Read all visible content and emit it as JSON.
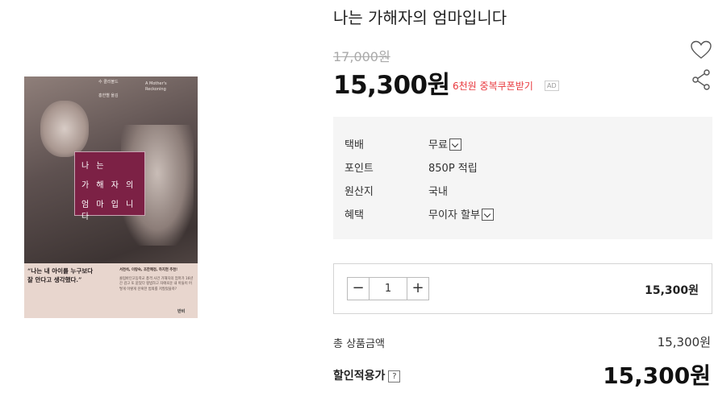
{
  "product": {
    "title": "나는 가해자의 엄마입니다",
    "original_price": "17,000원",
    "sale_price": "15,300원",
    "coupon_text": "6천원 중복쿠폰받기",
    "ad_badge": "AD"
  },
  "cover": {
    "author_line": "수 클리볼드",
    "translator_line": "홍한별 옮김",
    "english_title": "A Mother's Reckoning",
    "title_lines": [
      "나 는",
      "가 해 자 의",
      "엄 마 입 니 다"
    ],
    "quote": "“나는 내 아이를 누구보다 잘 안다고 생각했다.”",
    "recommenders": "서천석, 이랑숙, 조한혜정, 하지현 추천!",
    "blurb": "콜럼바인고등학교 총격 사건 가해자의 엄마가 16년간 감고 또 묻었다 평범하고 자애로운 내 아들이 어떻게 이렇게 잔혹한 범죄를 저질렀을까?",
    "publisher_logo": "반비"
  },
  "info": {
    "rows": [
      {
        "label": "택배",
        "value": "무료",
        "dropdown": true
      },
      {
        "label": "포인트",
        "value": "850P 적립",
        "dropdown": false
      },
      {
        "label": "원산지",
        "value": "국내",
        "dropdown": false
      },
      {
        "label": "혜택",
        "value": "무이자 할부",
        "dropdown": true
      }
    ]
  },
  "quantity": {
    "minus": "−",
    "plus": "+",
    "value": "1",
    "line_total": "15,300원"
  },
  "summary": {
    "total_label": "총 상품금액",
    "total_value": "15,300원",
    "final_label": "할인적용가",
    "help_icon": "?",
    "final_value": "15,300원"
  },
  "colors": {
    "coupon_red": "#e8383d",
    "cover_title_box": "#7c2145",
    "info_bg": "#f5f5f5"
  },
  "icons": [
    "heart-icon",
    "share-icon",
    "chevron-down-icon"
  ]
}
